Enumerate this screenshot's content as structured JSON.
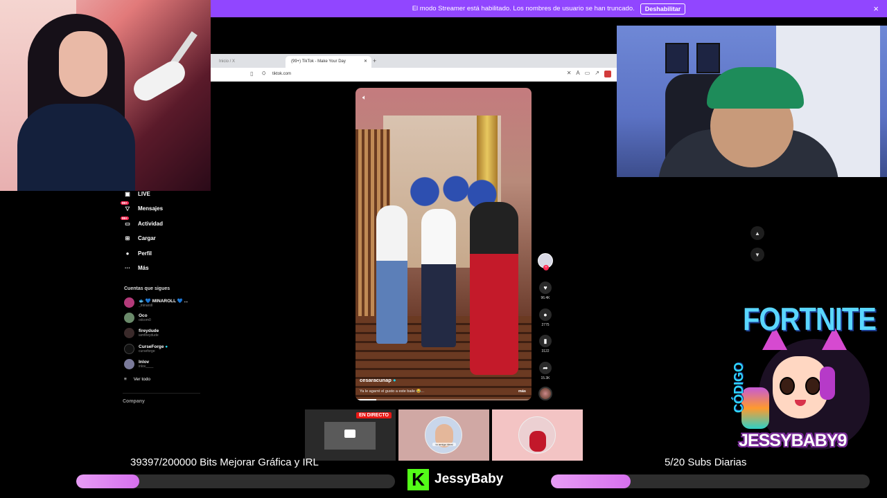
{
  "banner": {
    "message": "El modo Streamer está habilitado. Los nombres de usuario se han truncado.",
    "button": "Deshabilitar",
    "close_icon": "×",
    "color": "#9146ff"
  },
  "browser": {
    "inactive_tab": "Inicio / X",
    "active_tab": "(99+) TikTok - Make Your Day",
    "new_tab_icon": "+",
    "url": "tiktok.com"
  },
  "sidebar": {
    "items": [
      {
        "label": "LIVE",
        "icon": "live-icon"
      },
      {
        "label": "Mensajes",
        "icon": "messages-icon",
        "badge": "99+"
      },
      {
        "label": "Actividad",
        "icon": "activity-icon",
        "badge": "99+"
      },
      {
        "label": "Cargar",
        "icon": "upload-icon"
      },
      {
        "label": "Perfil",
        "icon": "profile-icon"
      },
      {
        "label": "Más",
        "icon": "more-icon"
      }
    ],
    "following_title": "Cuentas que sigues",
    "following": [
      {
        "name": "🐟 💙 MINAROLL 💙 ...",
        "handle": "_minaroll"
      },
      {
        "name": "Oco",
        "handle": "odcom0"
      },
      {
        "name": "fireydude",
        "handle": "iamfireydude"
      },
      {
        "name": "CurseForge",
        "handle": "curseforge"
      },
      {
        "name": "Inlov",
        "handle": "inlov____"
      }
    ],
    "see_all": "Ver todo",
    "company": "Company"
  },
  "video": {
    "username": "cesaracunap",
    "caption": "Ya le agarré el gusto a este baile 😂...",
    "more": "más",
    "likes": "96.4K",
    "comments": "2775",
    "saves": "3122",
    "shares": "15.3K",
    "progress": 0.12
  },
  "thumbnails": {
    "live_label": "EN DIRECTO",
    "thumb2_caption": "tu amigo ideal"
  },
  "overlay": {
    "fortnite": "FORTNITE",
    "codigo": "CÓDIGO",
    "code": "JESSYBABY9"
  },
  "goals": {
    "bits_text": "39397/200000 Bits Mejorar Gráfica y IRL",
    "bits_progress": 0.197,
    "subs_text": "5/20 Subs Diarias",
    "subs_progress": 0.25
  },
  "brand": {
    "logo_letter": "K",
    "name": "JessyBaby",
    "logo_color": "#53fc18"
  }
}
